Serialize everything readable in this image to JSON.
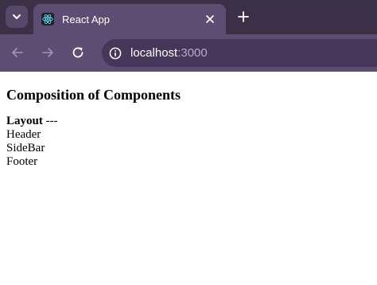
{
  "browser": {
    "tab": {
      "title": "React App"
    },
    "address": {
      "host": "localhost",
      "port": ":3000"
    }
  },
  "page": {
    "heading": "Composition of Components",
    "layout_label": "Layout",
    "layout_suffix": " ---",
    "items": [
      "Header",
      "SideBar",
      "Footer"
    ]
  },
  "icons": {
    "tab_search": "chevron-down-icon",
    "favicon": "react-logo-icon",
    "close": "close-icon",
    "new_tab": "plus-icon",
    "back": "arrow-left-icon",
    "forward": "arrow-right-icon",
    "reload": "reload-icon",
    "site_info": "info-icon"
  },
  "colors": {
    "tabstrip_bg": "#3c3049",
    "toolbar_bg": "#5d4d72",
    "omnibox_bg": "#45375a",
    "react_blue": "#61dafb"
  }
}
